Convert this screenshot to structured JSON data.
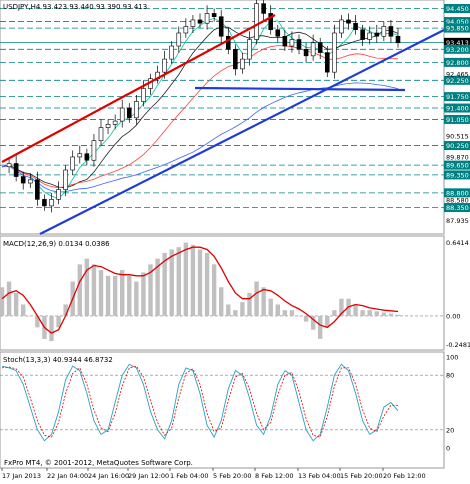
{
  "chart_data": [
    {
      "type": "candlestick",
      "title": "USDJPY,H4  93.423 93.440 93.390 93.413",
      "ylim": [
        87.6,
        94.65
      ],
      "price_levels": [
        {
          "value": 94.45,
          "label": "94.450"
        },
        {
          "value": 94.05,
          "label": "94.050"
        },
        {
          "value": 93.85,
          "label": "93.850"
        },
        {
          "value": 93.413,
          "label": "93.413",
          "current": true
        },
        {
          "value": 93.2,
          "label": "93.200"
        },
        {
          "value": 92.8,
          "label": "92.800"
        },
        {
          "value": 92.25,
          "label": "92.250"
        },
        {
          "value": 91.75,
          "label": "91.750"
        },
        {
          "value": 91.4,
          "label": "91.400"
        },
        {
          "value": 91.05,
          "label": "91.050"
        },
        {
          "value": 90.25,
          "label": "90.250"
        },
        {
          "value": 89.65,
          "label": "89.650"
        },
        {
          "value": 89.35,
          "label": "89.350"
        },
        {
          "value": 88.8,
          "label": "88.800"
        },
        {
          "value": 88.35,
          "label": "88.350"
        }
      ],
      "axis_ticks": [
        {
          "value": 92.45,
          "label": "92.465"
        },
        {
          "value": 90.55,
          "label": "90.515"
        },
        {
          "value": 89.9,
          "label": "89.870"
        },
        {
          "value": 88.58,
          "label": "88.580"
        },
        {
          "value": 87.95,
          "label": "87.935"
        }
      ],
      "close_path": [
        89.6,
        89.7,
        89.3,
        89.1,
        89.2,
        88.6,
        88.4,
        88.6,
        88.9,
        89.5,
        89.9,
        90.0,
        89.8,
        90.4,
        90.8,
        90.9,
        91.0,
        91.4,
        91.1,
        91.6,
        92.0,
        92.3,
        92.5,
        92.9,
        93.3,
        93.7,
        93.9,
        94.1,
        94.0,
        94.3,
        94.2,
        93.6,
        93.2,
        92.6,
        92.9,
        93.5,
        94.6,
        94.3,
        93.8,
        93.6,
        93.3,
        93.5,
        93.2,
        93.0,
        93.4,
        93.1,
        92.5,
        93.7,
        94.1,
        94.0,
        93.8,
        93.5,
        93.7,
        93.6,
        93.9,
        93.6,
        93.4
      ]
    },
    {
      "type": "line",
      "title": "MACD(12,26,9) 0.0134 0.0386",
      "ylim": [
        -0.28,
        0.68
      ],
      "axis_ticks": [
        {
          "value": 0.6414,
          "label": "0.6414"
        },
        {
          "value": 0.0,
          "label": "0.00"
        },
        {
          "value": -0.2481,
          "label": "-0.2481"
        }
      ],
      "histogram": [
        0.25,
        0.3,
        0.2,
        0.1,
        0.0,
        -0.1,
        -0.2,
        -0.22,
        -0.1,
        0.1,
        0.3,
        0.45,
        0.5,
        0.45,
        0.4,
        0.35,
        0.35,
        0.4,
        0.35,
        0.3,
        0.38,
        0.45,
        0.5,
        0.55,
        0.58,
        0.6,
        0.64,
        0.62,
        0.58,
        0.55,
        0.45,
        0.25,
        0.1,
        0.05,
        0.12,
        0.2,
        0.3,
        0.25,
        0.15,
        0.1,
        0.05,
        0.05,
        0.0,
        -0.05,
        -0.12,
        -0.2,
        -0.1,
        0.05,
        0.15,
        0.15,
        0.1,
        0.05,
        0.05,
        0.04,
        0.03,
        0.02,
        0.01
      ],
      "signal": [
        0.15,
        0.2,
        0.22,
        0.18,
        0.1,
        0.0,
        -0.1,
        -0.15,
        -0.12,
        0.0,
        0.15,
        0.3,
        0.4,
        0.44,
        0.43,
        0.4,
        0.37,
        0.36,
        0.36,
        0.35,
        0.35,
        0.38,
        0.43,
        0.48,
        0.52,
        0.55,
        0.58,
        0.6,
        0.6,
        0.58,
        0.52,
        0.42,
        0.3,
        0.2,
        0.15,
        0.15,
        0.2,
        0.23,
        0.22,
        0.18,
        0.13,
        0.09,
        0.06,
        0.02,
        -0.03,
        -0.08,
        -0.1,
        -0.05,
        0.02,
        0.08,
        0.1,
        0.09,
        0.07,
        0.06,
        0.05,
        0.045,
        0.0386
      ]
    },
    {
      "type": "line",
      "title": "Stoch(13,3,3) 40.9344 46.8732",
      "ylim": [
        0,
        100
      ],
      "axis_ticks": [
        {
          "value": 100,
          "label": "100"
        },
        {
          "value": 80,
          "label": "80"
        },
        {
          "value": 20,
          "label": "20"
        },
        {
          "value": 0,
          "label": "0"
        }
      ],
      "main": [
        90,
        88,
        85,
        70,
        45,
        20,
        8,
        15,
        40,
        75,
        90,
        85,
        60,
        30,
        15,
        20,
        50,
        80,
        92,
        88,
        70,
        40,
        20,
        10,
        30,
        70,
        88,
        85,
        60,
        25,
        12,
        30,
        65,
        85,
        80,
        55,
        25,
        15,
        35,
        70,
        85,
        80,
        50,
        20,
        8,
        15,
        45,
        80,
        92,
        85,
        60,
        30,
        15,
        20,
        45,
        50,
        40.9
      ],
      "signal": [
        88,
        89,
        87,
        78,
        55,
        30,
        14,
        12,
        28,
        60,
        82,
        88,
        70,
        42,
        22,
        18,
        38,
        68,
        88,
        90,
        78,
        52,
        28,
        14,
        22,
        55,
        82,
        87,
        70,
        38,
        18,
        22,
        52,
        78,
        82,
        65,
        38,
        20,
        28,
        58,
        80,
        83,
        62,
        32,
        14,
        12,
        35,
        68,
        88,
        88,
        70,
        42,
        22,
        18,
        35,
        47,
        46.9
      ]
    }
  ],
  "xaxis": {
    "labels": [
      "17 Jan 2013",
      "22 Jan 04:00",
      "24 Jan 16:00",
      "29 Jan 12:00",
      "1 Feb 04:00",
      "5 Feb 20:00",
      "8 Feb 12:00",
      "13 Feb 04:00",
      "15 Feb 20:00",
      "20 Feb 12:00"
    ]
  },
  "footer": {
    "copyright": "FxPro MT4, © 2001-2012, MetaQuotes Software Corp."
  },
  "colors": {
    "background": "#ffffff",
    "grid": "#7f7f7f",
    "level_line": "#008080",
    "label_box": "#008080",
    "up_candle": "#000000",
    "down_candle": "#000000",
    "trend_red": "#e00000",
    "trend_blue": "#1f3bd6",
    "ma_red": "#ff4040",
    "ma_green": "#00c8a0",
    "ma_black": "#202020",
    "ma_blue": "#4060ff",
    "macd_hist": "#c0c0c0",
    "macd_signal": "#e00000",
    "stoch_main": "#2aa0c0",
    "stoch_signal": "#e00000"
  }
}
